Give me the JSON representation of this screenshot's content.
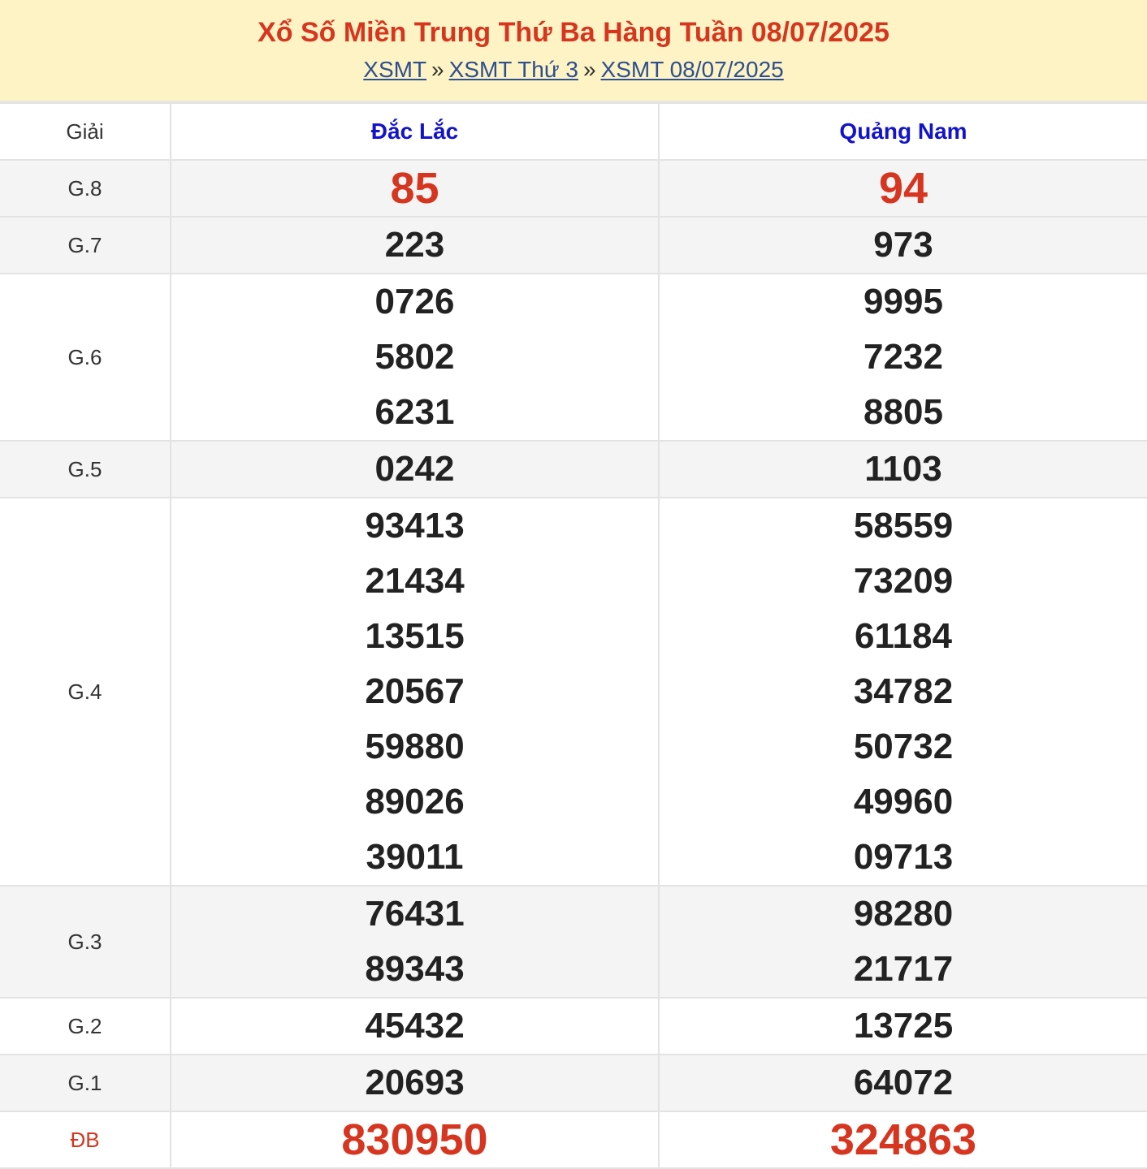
{
  "header": {
    "title": "Xổ Số Miền Trung Thứ Ba Hàng Tuần 08/07/2025",
    "breadcrumb": [
      {
        "label": "XSMT"
      },
      {
        "label": "XSMT Thứ 3"
      },
      {
        "label": "XSMT 08/07/2025"
      }
    ],
    "separator": "»"
  },
  "table": {
    "label_header": "Giải",
    "provinces": [
      "Đắc Lắc",
      "Quảng Nam"
    ],
    "prizes": [
      {
        "label": "G.8",
        "values": [
          [
            "85"
          ],
          [
            "94"
          ]
        ]
      },
      {
        "label": "G.7",
        "values": [
          [
            "223"
          ],
          [
            "973"
          ]
        ]
      },
      {
        "label": "G.6",
        "values": [
          [
            "0726",
            "5802",
            "6231"
          ],
          [
            "9995",
            "7232",
            "8805"
          ]
        ]
      },
      {
        "label": "G.5",
        "values": [
          [
            "0242"
          ],
          [
            "1103"
          ]
        ]
      },
      {
        "label": "G.4",
        "values": [
          [
            "93413",
            "21434",
            "13515",
            "20567",
            "59880",
            "89026",
            "39011"
          ],
          [
            "58559",
            "73209",
            "61184",
            "34782",
            "50732",
            "49960",
            "09713"
          ]
        ]
      },
      {
        "label": "G.3",
        "values": [
          [
            "76431",
            "89343"
          ],
          [
            "98280",
            "21717"
          ]
        ]
      },
      {
        "label": "G.2",
        "values": [
          [
            "45432"
          ],
          [
            "13725"
          ]
        ]
      },
      {
        "label": "G.1",
        "values": [
          [
            "20693"
          ],
          [
            "64072"
          ]
        ]
      },
      {
        "label": "ĐB",
        "values": [
          [
            "830950"
          ],
          [
            "324863"
          ]
        ]
      }
    ]
  },
  "colors": {
    "header_bg": "#fdf3c4",
    "title_red": "#d6361f",
    "link_blue": "#2e4f8f",
    "province_blue": "#1313c9"
  }
}
